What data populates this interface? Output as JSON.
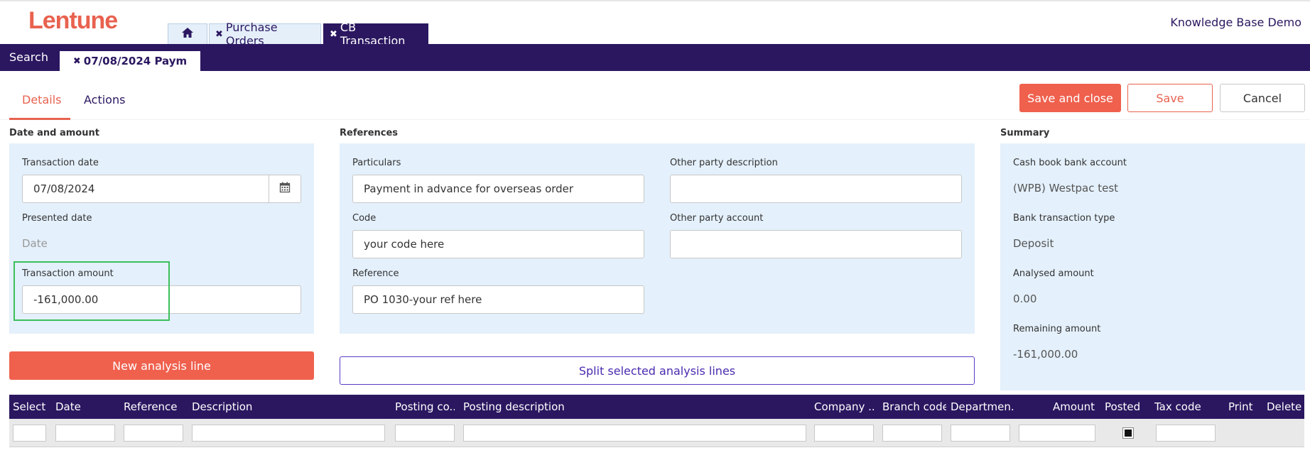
{
  "app": {
    "logo": "Lentune",
    "company": "Knowledge Base Demo"
  },
  "tabs": [
    {
      "icon": "home-icon"
    },
    {
      "label": "Purchase Orders",
      "close": "✖"
    },
    {
      "label": "CB Transaction",
      "close": "✖"
    }
  ],
  "navbar": {
    "search": "Search",
    "record_tab": "07/08/2024 Paym",
    "record_close": "✖"
  },
  "subtabs": {
    "details": "Details",
    "actions": "Actions"
  },
  "toolbar": {
    "save_close": "Save and close",
    "save": "Save",
    "cancel": "Cancel"
  },
  "date_amount": {
    "title": "Date and amount",
    "transaction_date_label": "Transaction date",
    "transaction_date_value": "07/08/2024",
    "presented_date_label": "Presented date",
    "presented_date_placeholder": "Date",
    "transaction_amount_label": "Transaction amount",
    "transaction_amount_value": "-161,000.00"
  },
  "references": {
    "title": "References",
    "particulars_label": "Particulars",
    "particulars_value": "Payment in advance for overseas order",
    "code_label": "Code",
    "code_value": "your code here",
    "reference_label": "Reference",
    "reference_value": "PO 1030-your ref here",
    "other_party_description_label": "Other party description",
    "other_party_description_value": "",
    "other_party_account_label": "Other party account",
    "other_party_account_value": ""
  },
  "summary": {
    "title": "Summary",
    "bank_account_label": "Cash book bank account",
    "bank_account_value": "(WPB) Westpac test",
    "bank_type_label": "Bank transaction type",
    "bank_type_value": "Deposit",
    "analysed_label": "Analysed amount",
    "analysed_value": "0.00",
    "remaining_label": "Remaining amount",
    "remaining_value": "-161,000.00"
  },
  "buttons": {
    "new_analysis": "New analysis line",
    "split": "Split selected analysis lines"
  },
  "grid": {
    "columns": [
      "Select",
      "Date",
      "Reference",
      "Description",
      "Posting co...",
      "Posting description",
      "Company ...",
      "Branch code",
      "Departmen...",
      "Amount",
      "Posted",
      "Tax code",
      "Print",
      "Delete"
    ]
  },
  "colors": {
    "brand": "#e8624f",
    "navy": "#2b1760",
    "panel": "#e4f0fb"
  }
}
